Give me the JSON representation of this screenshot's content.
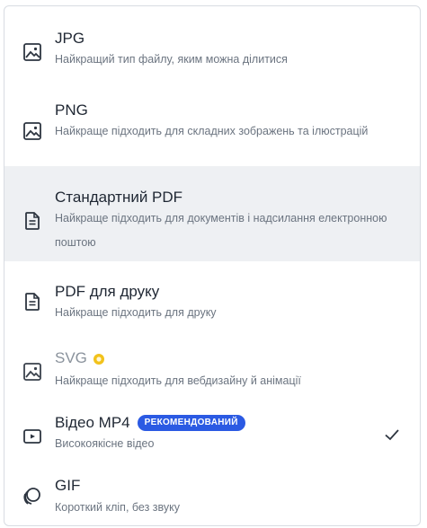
{
  "formats": [
    {
      "id": "jpg",
      "title": "JPG",
      "description": "Найкращий тип файлу, яким можна ділитися",
      "icon": "image-icon"
    },
    {
      "id": "png",
      "title": "PNG",
      "description": "Найкраще підходить для складних зображень та ілюстрацій",
      "icon": "image-icon"
    },
    {
      "id": "pdf-standard",
      "title": "Стандартний PDF",
      "description": "Найкраще підходить для документів і надсилання електронною поштою",
      "icon": "document-icon"
    },
    {
      "id": "pdf-print",
      "title": "PDF для друку",
      "description": "Найкраще підходить для друку",
      "icon": "document-icon"
    },
    {
      "id": "svg",
      "title": "SVG",
      "description": "Найкраще підходить для вебдизайну й анімації",
      "icon": "image-icon"
    },
    {
      "id": "mp4",
      "title": "Відео MP4",
      "badge": "РЕКОМЕНДОВАНИЙ",
      "description": "Високоякісне відео",
      "icon": "video-icon"
    },
    {
      "id": "gif",
      "title": "GIF",
      "description": "Короткий кліп, без звуку",
      "icon": "gif-icon"
    }
  ],
  "colors": {
    "badge": "#2b5ae3",
    "pro": "#f2c21b",
    "selected_bg": "#eef0f3"
  }
}
